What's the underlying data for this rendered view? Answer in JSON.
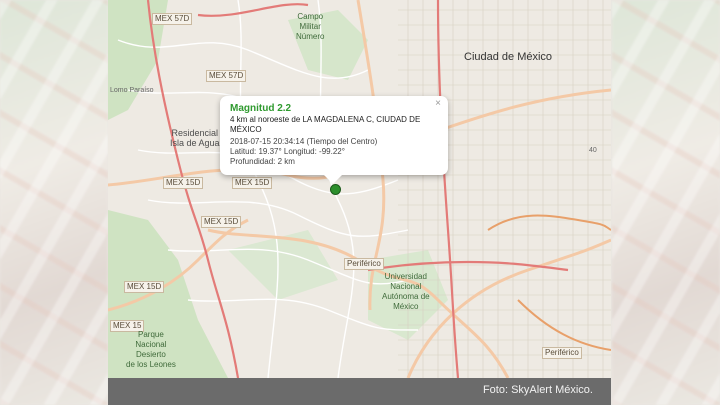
{
  "map": {
    "city": "Ciudad de México",
    "road_labels": [
      "MEX 57D",
      "MEX 57D",
      "MEX 15D",
      "MEX 15D",
      "MEX 15D",
      "MEX 15D",
      "MEX 15",
      "Periférico",
      "Periférico"
    ],
    "place_labels": {
      "campo_militar": "Campo\nMilitar\nNúmero",
      "residencial": "Residencial\nIsla de Agua",
      "lomo_paraiso": "Lomo Paraíso",
      "unam": "Universidad\nNacional\nAutónoma de\nMéxico",
      "parque": "Parque\nNacional\nDesierto\nde los Leones",
      "route_40": "40"
    }
  },
  "popup": {
    "title": "Magnitud 2.2",
    "place": "4 km al noroeste de LA MAGDALENA C, CIUDAD DE MÉXICO",
    "datetime": "2018-07-15  20:34:14 (Tiempo del Centro)",
    "coords": "Latitud: 19.37°  Longitud: -99.22°",
    "depth": "Profundidad: 2 km",
    "close": "×"
  },
  "caption": "Foto: SkyAlert México.",
  "colors": {
    "magnitude": "#2f9a2f",
    "marker": "#2c8f2c",
    "caption_bar": "#6b6b6b"
  }
}
